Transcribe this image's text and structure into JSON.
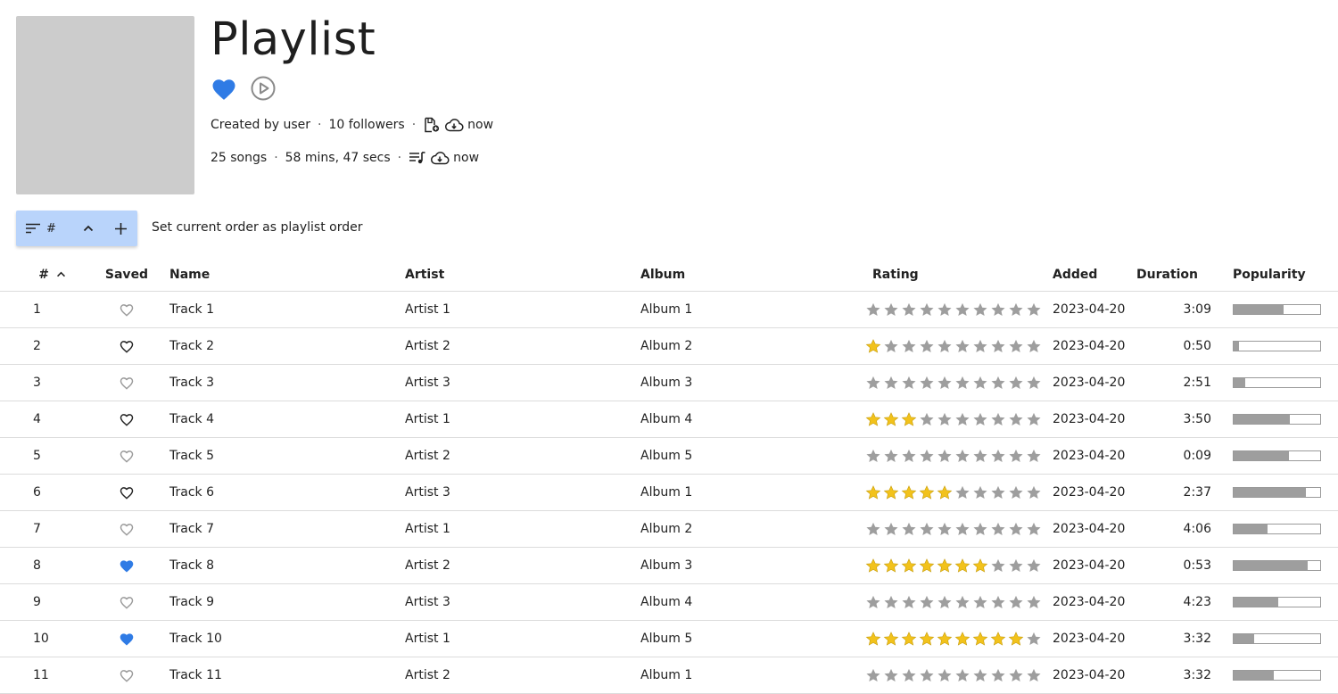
{
  "playlist": {
    "title": "Playlist",
    "created_by": "Created by user",
    "followers": "10 followers",
    "songs": "25 songs",
    "duration": "58 mins, 47 secs",
    "sync1": "now",
    "sync2": "now",
    "liked": true
  },
  "toolbar": {
    "sort_label": "#",
    "set_order": "Set current order as playlist order"
  },
  "colors": {
    "accent": "#2f7be5",
    "toolbar_bg": "#b9d4fb",
    "star_on": "#f2c21b",
    "star_off": "#9e9e9e"
  },
  "icons": [
    "heart-icon",
    "play-icon",
    "playlist-file-icon",
    "cloud-download-icon",
    "queue-music-icon",
    "sort-icon",
    "chevron-up-icon",
    "plus-icon",
    "star-icon"
  ],
  "columns": {
    "num": "#",
    "saved": "Saved",
    "name": "Name",
    "artist": "Artist",
    "album": "Album",
    "rating": "Rating",
    "added": "Added",
    "duration": "Duration",
    "popularity": "Popularity"
  },
  "tracks": [
    {
      "num": "1",
      "saved": "none",
      "name": "Track 1",
      "artist": "Artist 1",
      "album": "Album 1",
      "rating": 0,
      "added": "2023-04-20",
      "duration": "3:09",
      "popularity": 0.58
    },
    {
      "num": "2",
      "saved": "outline",
      "name": "Track 2",
      "artist": "Artist 2",
      "album": "Album 2",
      "rating": 1,
      "added": "2023-04-20",
      "duration": "0:50",
      "popularity": 0.06
    },
    {
      "num": "3",
      "saved": "none",
      "name": "Track 3",
      "artist": "Artist 3",
      "album": "Album 3",
      "rating": 0,
      "added": "2023-04-20",
      "duration": "2:51",
      "popularity": 0.13
    },
    {
      "num": "4",
      "saved": "outline",
      "name": "Track 4",
      "artist": "Artist 1",
      "album": "Album 4",
      "rating": 3,
      "added": "2023-04-20",
      "duration": "3:50",
      "popularity": 0.65
    },
    {
      "num": "5",
      "saved": "none",
      "name": "Track 5",
      "artist": "Artist 2",
      "album": "Album 5",
      "rating": 0,
      "added": "2023-04-20",
      "duration": "0:09",
      "popularity": 0.64
    },
    {
      "num": "6",
      "saved": "outline",
      "name": "Track 6",
      "artist": "Artist 3",
      "album": "Album 1",
      "rating": 5,
      "added": "2023-04-20",
      "duration": "2:37",
      "popularity": 0.84
    },
    {
      "num": "7",
      "saved": "none",
      "name": "Track 7",
      "artist": "Artist 1",
      "album": "Album 2",
      "rating": 0,
      "added": "2023-04-20",
      "duration": "4:06",
      "popularity": 0.39
    },
    {
      "num": "8",
      "saved": "filled",
      "name": "Track 8",
      "artist": "Artist 2",
      "album": "Album 3",
      "rating": 7,
      "added": "2023-04-20",
      "duration": "0:53",
      "popularity": 0.86
    },
    {
      "num": "9",
      "saved": "none",
      "name": "Track 9",
      "artist": "Artist 3",
      "album": "Album 4",
      "rating": 0,
      "added": "2023-04-20",
      "duration": "4:23",
      "popularity": 0.52
    },
    {
      "num": "10",
      "saved": "filled",
      "name": "Track 10",
      "artist": "Artist 1",
      "album": "Album 5",
      "rating": 9,
      "added": "2023-04-20",
      "duration": "3:32",
      "popularity": 0.24
    },
    {
      "num": "11",
      "saved": "none",
      "name": "Track 11",
      "artist": "Artist 2",
      "album": "Album 1",
      "rating": 0,
      "added": "2023-04-20",
      "duration": "3:32",
      "popularity": 0.46
    }
  ]
}
